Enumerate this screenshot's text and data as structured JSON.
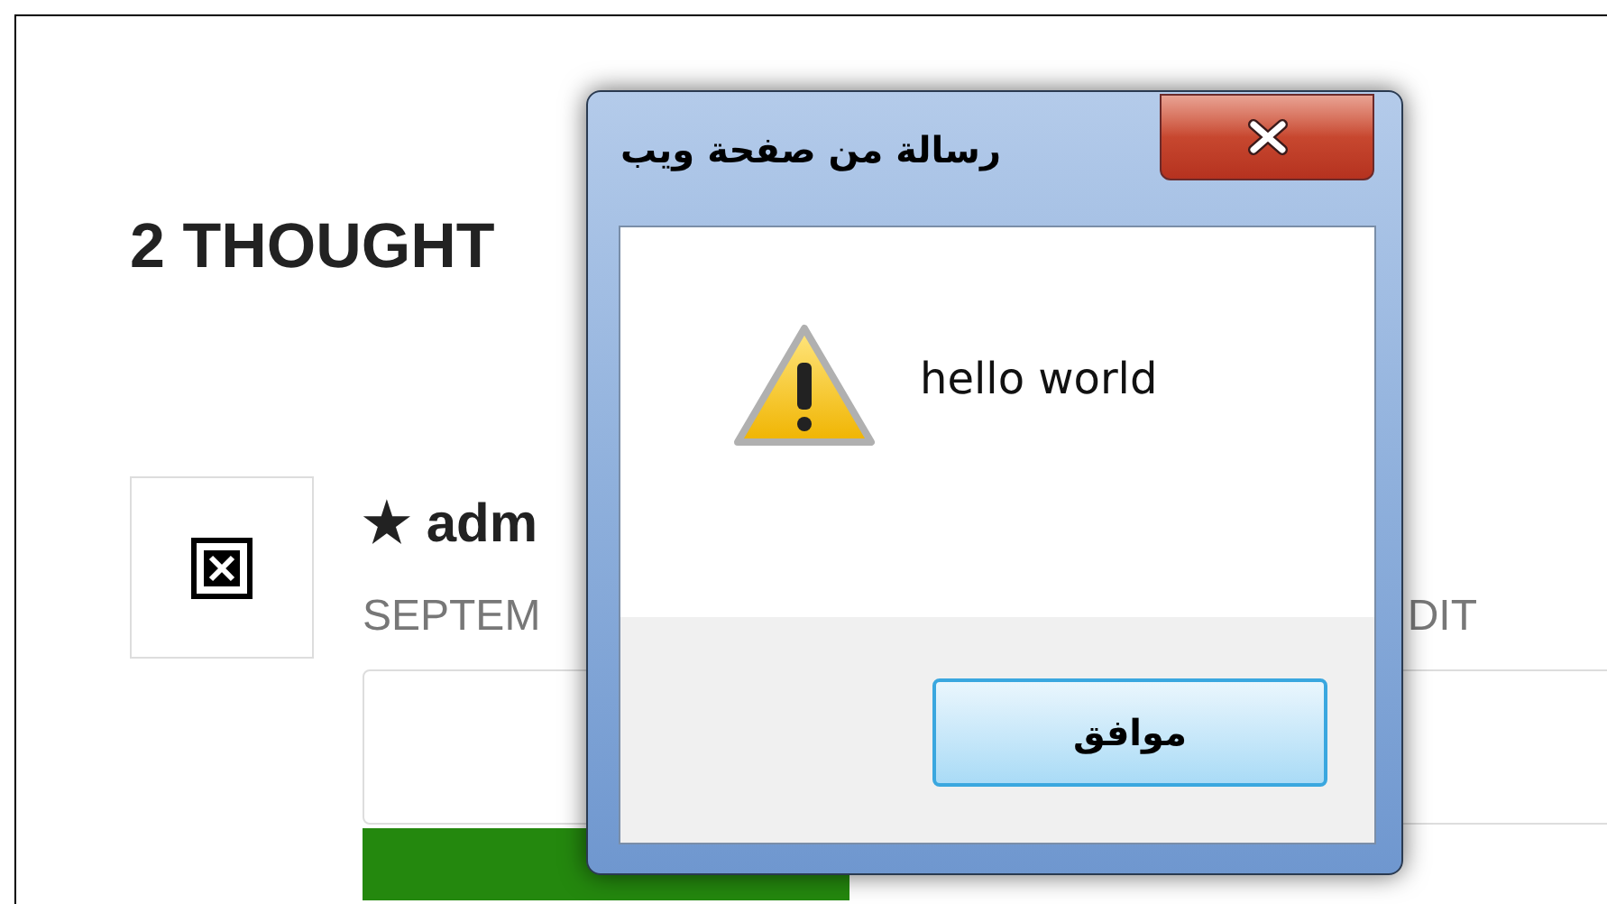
{
  "page": {
    "heading": "2 THOUGHT",
    "comment": {
      "author": "★ adm",
      "date": "SEPTEM",
      "action": "DIT"
    }
  },
  "dialog": {
    "title": "رسالة من صفحة ويب",
    "message": "hello world",
    "button": "موافق"
  }
}
